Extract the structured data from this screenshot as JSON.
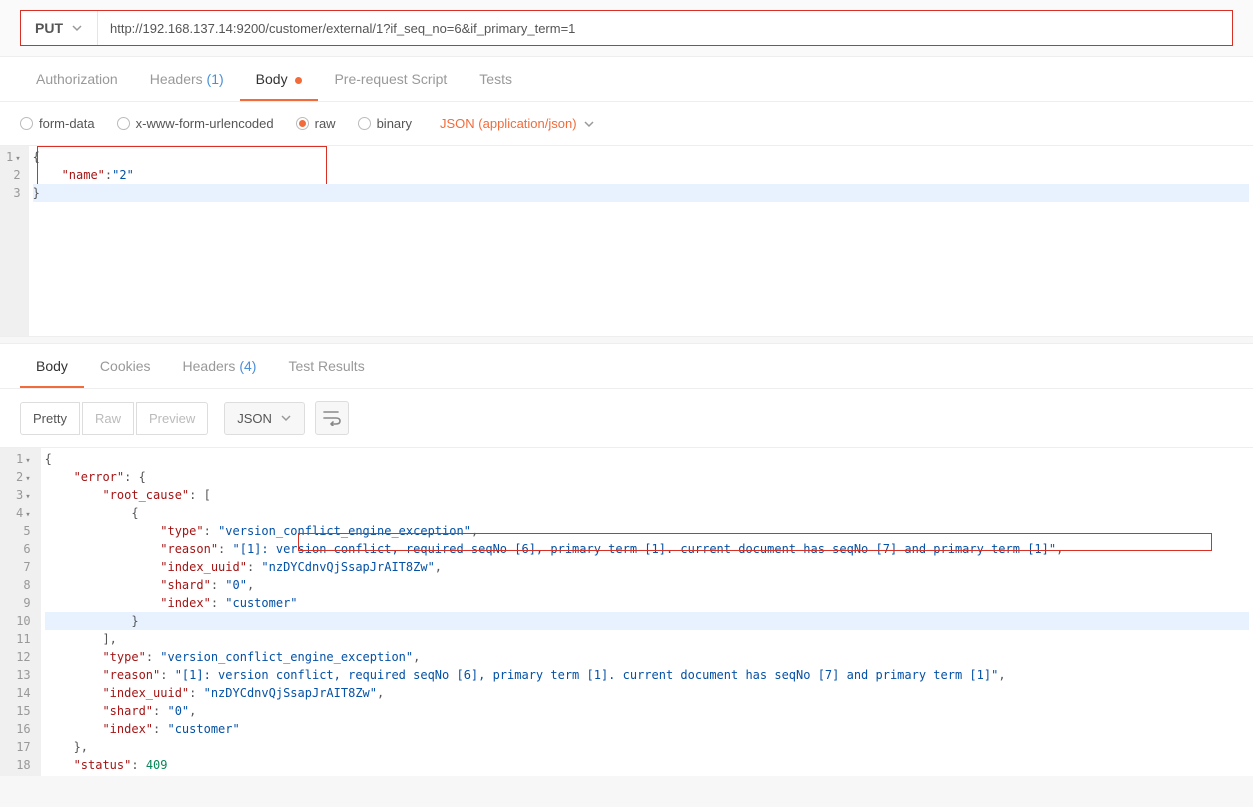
{
  "request": {
    "method": "PUT",
    "url": "http://192.168.137.14:9200/customer/external/1?if_seq_no=6&if_primary_term=1"
  },
  "reqTabs": {
    "authorization": "Authorization",
    "headers": "Headers",
    "headersCount": "(1)",
    "body": "Body",
    "preReq": "Pre-request Script",
    "tests": "Tests"
  },
  "bodyTypes": {
    "formData": "form-data",
    "urlEnc": "x-www-form-urlencoded",
    "raw": "raw",
    "binary": "binary",
    "contentType": "JSON (application/json)"
  },
  "reqBody": {
    "l1": "{",
    "l2_k": "\"name\"",
    "l2_sep": ":",
    "l2_v": "\"2\"",
    "l3": "}"
  },
  "respTabs": {
    "body": "Body",
    "cookies": "Cookies",
    "headers": "Headers",
    "headersCount": "(4)",
    "testResults": "Test Results"
  },
  "respToolbar": {
    "pretty": "Pretty",
    "raw": "Raw",
    "preview": "Preview",
    "format": "JSON"
  },
  "response": {
    "lines": [
      {
        "n": "1",
        "exp": true,
        "indent": 0,
        "parts": [
          {
            "t": "{"
          }
        ]
      },
      {
        "n": "2",
        "exp": true,
        "indent": 1,
        "parts": [
          {
            "k": "\"error\""
          },
          {
            "t": ": {"
          }
        ]
      },
      {
        "n": "3",
        "exp": true,
        "indent": 2,
        "parts": [
          {
            "k": "\"root_cause\""
          },
          {
            "t": ": ["
          }
        ]
      },
      {
        "n": "4",
        "exp": true,
        "indent": 3,
        "parts": [
          {
            "t": "{"
          }
        ]
      },
      {
        "n": "5",
        "indent": 4,
        "parts": [
          {
            "k": "\"type\""
          },
          {
            "t": ": "
          },
          {
            "s": "\"version_conflict_engine_exception\""
          },
          {
            "t": ","
          }
        ]
      },
      {
        "n": "6",
        "indent": 4,
        "parts": [
          {
            "k": "\"reason\""
          },
          {
            "t": ": "
          },
          {
            "s": "\"[1]: version conflict, required seqNo [6], primary term [1]. current document has seqNo [7] and primary term [1]\""
          },
          {
            "t": ","
          }
        ]
      },
      {
        "n": "7",
        "indent": 4,
        "parts": [
          {
            "k": "\"index_uuid\""
          },
          {
            "t": ": "
          },
          {
            "s": "\"nzDYCdnvQjSsapJrAIT8Zw\""
          },
          {
            "t": ","
          }
        ]
      },
      {
        "n": "8",
        "indent": 4,
        "parts": [
          {
            "k": "\"shard\""
          },
          {
            "t": ": "
          },
          {
            "s": "\"0\""
          },
          {
            "t": ","
          }
        ]
      },
      {
        "n": "9",
        "indent": 4,
        "parts": [
          {
            "k": "\"index\""
          },
          {
            "t": ": "
          },
          {
            "s": "\"customer\""
          }
        ]
      },
      {
        "n": "10",
        "hl": true,
        "indent": 3,
        "parts": [
          {
            "t": "}"
          }
        ]
      },
      {
        "n": "11",
        "indent": 2,
        "parts": [
          {
            "t": "],"
          }
        ]
      },
      {
        "n": "12",
        "indent": 2,
        "parts": [
          {
            "k": "\"type\""
          },
          {
            "t": ": "
          },
          {
            "s": "\"version_conflict_engine_exception\""
          },
          {
            "t": ","
          }
        ]
      },
      {
        "n": "13",
        "indent": 2,
        "parts": [
          {
            "k": "\"reason\""
          },
          {
            "t": ": "
          },
          {
            "s": "\"[1]: version conflict, required seqNo [6], primary term [1]. current document has seqNo [7] and primary term [1]\""
          },
          {
            "t": ","
          }
        ]
      },
      {
        "n": "14",
        "indent": 2,
        "parts": [
          {
            "k": "\"index_uuid\""
          },
          {
            "t": ": "
          },
          {
            "s": "\"nzDYCdnvQjSsapJrAIT8Zw\""
          },
          {
            "t": ","
          }
        ]
      },
      {
        "n": "15",
        "indent": 2,
        "parts": [
          {
            "k": "\"shard\""
          },
          {
            "t": ": "
          },
          {
            "s": "\"0\""
          },
          {
            "t": ","
          }
        ]
      },
      {
        "n": "16",
        "indent": 2,
        "parts": [
          {
            "k": "\"index\""
          },
          {
            "t": ": "
          },
          {
            "s": "\"customer\""
          }
        ]
      },
      {
        "n": "17",
        "indent": 1,
        "parts": [
          {
            "t": "},"
          }
        ]
      },
      {
        "n": "18",
        "indent": 1,
        "parts": [
          {
            "k": "\"status\""
          },
          {
            "t": ": "
          },
          {
            "n": "409"
          }
        ]
      }
    ]
  }
}
